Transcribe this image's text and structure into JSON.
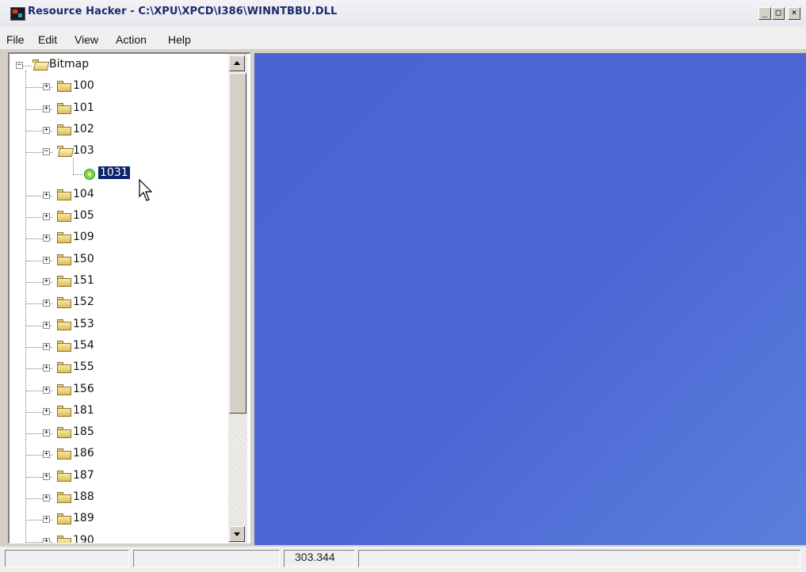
{
  "window": {
    "title": "Resource Hacker  -  C:\\XPU\\XPCD\\I386\\WINNTBBU.DLL",
    "buttons": {
      "minimize": "_",
      "maximize": "□",
      "close": "×"
    }
  },
  "menu": [
    "File",
    "Edit",
    "View",
    "Action",
    "Help"
  ],
  "tree": {
    "root": "Bitmap",
    "items": [
      {
        "label": "100",
        "expanded": false
      },
      {
        "label": "101",
        "expanded": false
      },
      {
        "label": "102",
        "expanded": false
      },
      {
        "label": "103",
        "expanded": true,
        "children": [
          {
            "label": "1031",
            "selected": true
          }
        ]
      },
      {
        "label": "104",
        "expanded": false
      },
      {
        "label": "105",
        "expanded": false
      },
      {
        "label": "109",
        "expanded": false
      },
      {
        "label": "150",
        "expanded": false
      },
      {
        "label": "151",
        "expanded": false
      },
      {
        "label": "152",
        "expanded": false
      },
      {
        "label": "153",
        "expanded": false
      },
      {
        "label": "154",
        "expanded": false
      },
      {
        "label": "155",
        "expanded": false
      },
      {
        "label": "156",
        "expanded": false
      },
      {
        "label": "181",
        "expanded": false
      },
      {
        "label": "185",
        "expanded": false
      },
      {
        "label": "186",
        "expanded": false
      },
      {
        "label": "187",
        "expanded": false
      },
      {
        "label": "188",
        "expanded": false
      },
      {
        "label": "189",
        "expanded": false
      },
      {
        "label": "190",
        "expanded": false
      }
    ]
  },
  "status": {
    "coords": "303.344"
  },
  "colors": {
    "preview": "#4a64d1",
    "selection": "#0a246a",
    "title_text": "#1a2a6e"
  },
  "icons": {
    "app": "resource-hacker-icon",
    "folder": "folder-icon",
    "resource": "bitmap-resource-icon"
  }
}
